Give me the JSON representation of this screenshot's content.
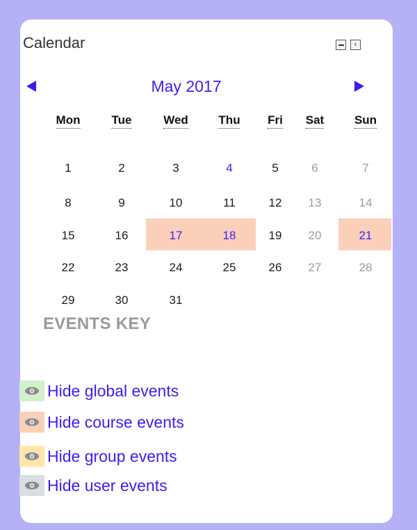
{
  "calendar": {
    "title": "Calendar",
    "month_label": "May 2017",
    "weekdays": [
      "Mon",
      "Tue",
      "Wed",
      "Thu",
      "Fri",
      "Sat",
      "Sun"
    ],
    "weeks": [
      [
        1,
        2,
        3,
        4,
        5,
        6,
        7
      ],
      [
        8,
        9,
        10,
        11,
        12,
        13,
        14
      ],
      [
        15,
        16,
        17,
        18,
        19,
        20,
        21
      ],
      [
        22,
        23,
        24,
        25,
        26,
        27,
        28
      ],
      [
        29,
        30,
        31,
        null,
        null,
        null,
        null
      ]
    ],
    "event_days": [
      4,
      17,
      18,
      21
    ],
    "course_event_days": [
      17,
      18,
      21
    ]
  },
  "events_key": {
    "heading": "EVENTS KEY",
    "items": [
      {
        "label": "Hide global events",
        "color": "#d3f0cd",
        "icon": "eye-icon"
      },
      {
        "label": "Hide course events",
        "color": "#fbd0bb",
        "icon": "eye-icon"
      },
      {
        "label": "Hide group events",
        "color": "#fde5ab",
        "icon": "eye-icon"
      },
      {
        "label": "Hide user events",
        "color": "#d8dfe2",
        "icon": "eye-icon"
      }
    ]
  },
  "colors": {
    "link": "#3a1ef0",
    "course_highlight": "#fbd0bb",
    "page_background": "#b4b1f6"
  }
}
